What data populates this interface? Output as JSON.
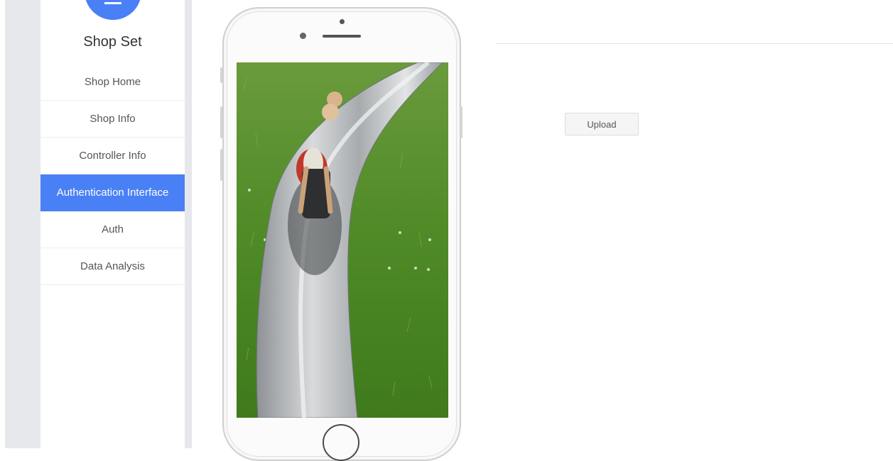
{
  "sidebar": {
    "shop_title": "Shop Set",
    "active_index": 3,
    "items": [
      {
        "label": "Shop Home"
      },
      {
        "label": "Shop Info"
      },
      {
        "label": "Controller Info"
      },
      {
        "label": "Authentication Interface"
      },
      {
        "label": "Auth"
      },
      {
        "label": "Data Analysis"
      }
    ]
  },
  "preview": {
    "image_icon": "phone-preview-image"
  },
  "main": {
    "upload_label": "Upload"
  },
  "colors": {
    "accent": "#4a80f5",
    "gutter": "#e6e8eb"
  }
}
